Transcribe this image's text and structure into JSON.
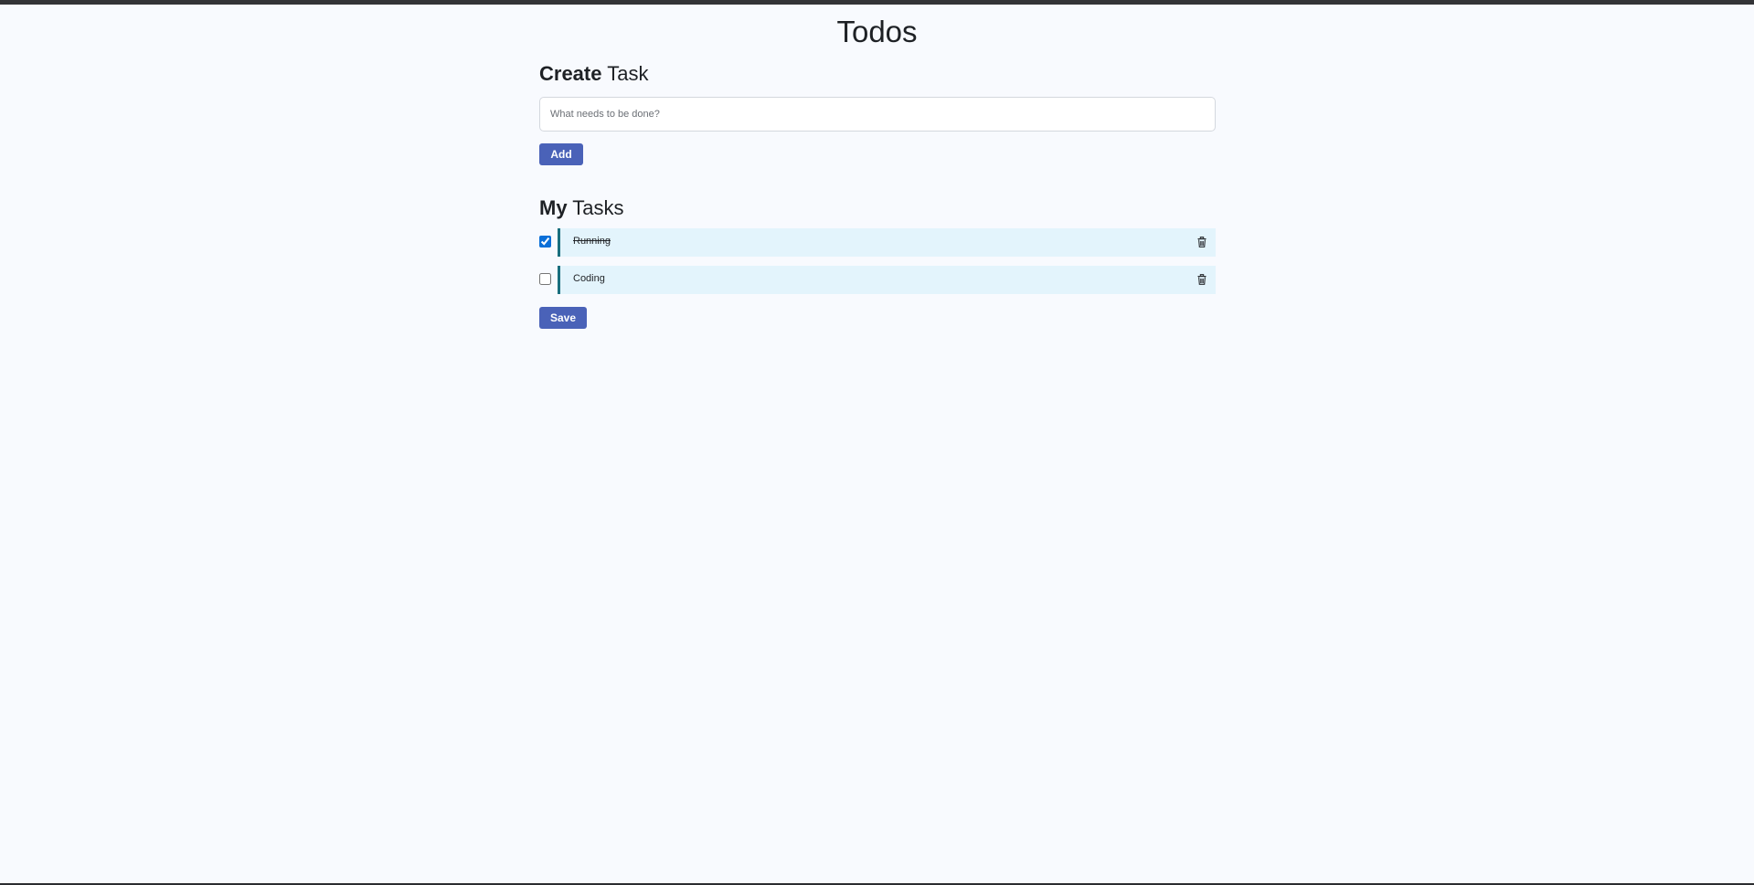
{
  "header": {
    "title": "Todos"
  },
  "create_section": {
    "heading_bold": "Create",
    "heading_rest": "Task",
    "input_placeholder": "What needs to be done?",
    "input_value": "",
    "add_label": "Add"
  },
  "tasks_section": {
    "heading_bold": "My",
    "heading_rest": "Tasks",
    "tasks": [
      {
        "label": "Running",
        "completed": true,
        "delete_icon": "trash-icon"
      },
      {
        "label": "Coding",
        "completed": false,
        "delete_icon": "trash-icon"
      }
    ],
    "save_label": "Save"
  },
  "colors": {
    "accent": "#4a62b8",
    "task_bg": "#e3f4fc",
    "task_border": "#1a6f7e",
    "page_bg": "#f8fafe"
  }
}
